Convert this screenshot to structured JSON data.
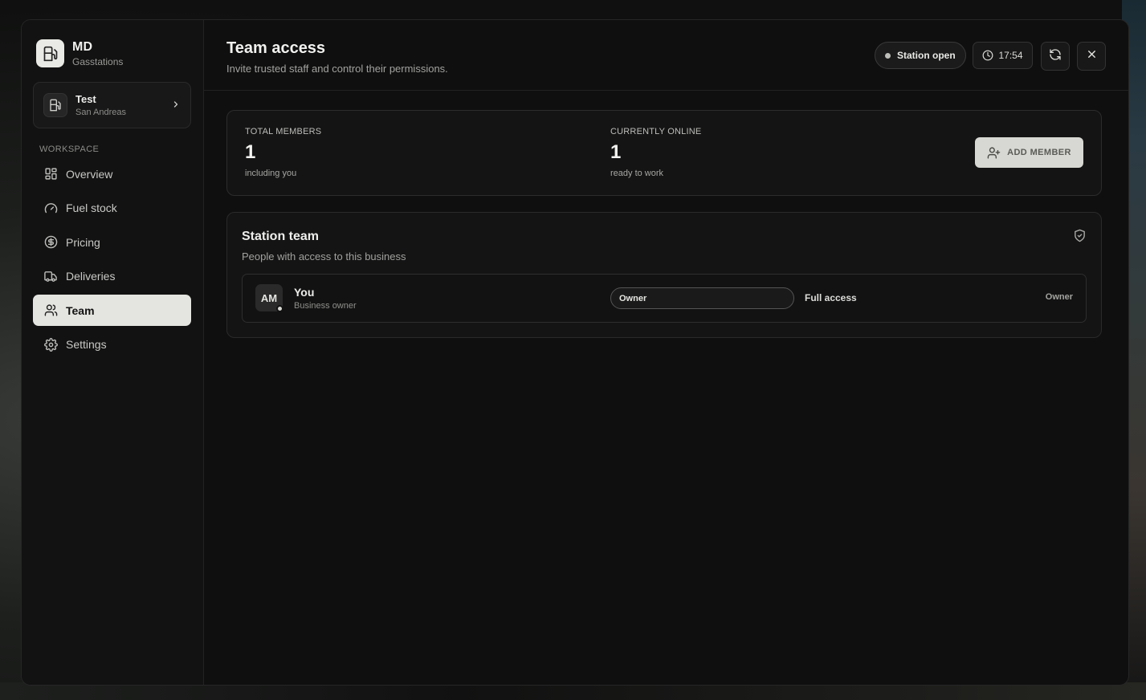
{
  "brand": {
    "title": "MD",
    "subtitle": "Gasstations"
  },
  "station": {
    "name": "Test",
    "location": "San Andreas"
  },
  "sidebar": {
    "section_label": "WORKSPACE",
    "items": [
      {
        "label": "Overview",
        "icon": "grid-icon"
      },
      {
        "label": "Fuel stock",
        "icon": "gauge-icon"
      },
      {
        "label": "Pricing",
        "icon": "dollar-icon"
      },
      {
        "label": "Deliveries",
        "icon": "truck-icon"
      },
      {
        "label": "Team",
        "icon": "users-icon",
        "active": true
      },
      {
        "label": "Settings",
        "icon": "gear-icon"
      }
    ]
  },
  "header": {
    "title": "Team access",
    "subtitle": "Invite trusted staff and control their permissions.",
    "status": "Station open",
    "time": "17:54"
  },
  "stats": {
    "total": {
      "label": "TOTAL MEMBERS",
      "value": "1",
      "note": "including you"
    },
    "online": {
      "label": "CURRENTLY ONLINE",
      "value": "1",
      "note": "ready to work"
    },
    "add_button": "ADD MEMBER"
  },
  "team": {
    "title": "Station team",
    "subtitle": "People with access to this business",
    "members": [
      {
        "initials": "AM",
        "name": "You",
        "role": "Business owner",
        "select_value": "Owner",
        "access": "Full access",
        "tag": "Owner"
      }
    ]
  },
  "colors": {
    "accent": "#e4e4e0",
    "background": "#0f0f0f",
    "panel": "#141414"
  }
}
